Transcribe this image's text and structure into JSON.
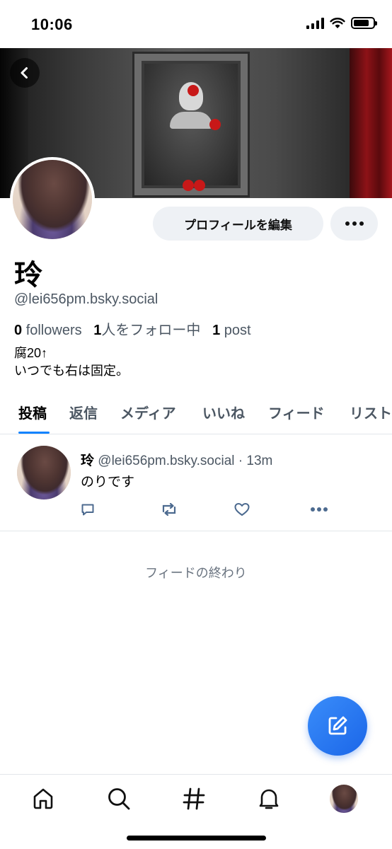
{
  "status_bar": {
    "time": "10:06",
    "battery_level": 0.8,
    "icons": [
      "signal-icon",
      "wifi-icon",
      "battery-icon"
    ]
  },
  "profile": {
    "display_name": "玲",
    "handle": "@lei656pm.bsky.social",
    "stats": {
      "followers_count": "0",
      "followers_label": "followers",
      "following_count": "1",
      "following_label": "人をフォロー中",
      "posts_count": "1",
      "posts_label": "post"
    },
    "bio_line1": "腐20↑",
    "bio_line2": "いつでも右は固定。",
    "edit_button": "プロフィールを編集"
  },
  "tabs": [
    {
      "label": "投稿",
      "active": true
    },
    {
      "label": "返信",
      "active": false
    },
    {
      "label": "メディア",
      "active": false
    },
    {
      "label": "いいね",
      "active": false
    },
    {
      "label": "フィード",
      "active": false
    },
    {
      "label": "リスト",
      "active": false
    }
  ],
  "post": {
    "author": "玲",
    "handle": "@lei656pm.bsky.social",
    "separator": "·",
    "time_ago": "13m",
    "text": "のりです"
  },
  "feed_end_text": "フィードの終わり",
  "bottom_nav": [
    "home-icon",
    "search-icon",
    "hashtag-icon",
    "bell-icon",
    "avatar"
  ],
  "colors": {
    "accent": "#1083fe",
    "fab": "#2a7cf3",
    "muted_text": "#4c5763",
    "button_bg": "#eef1f5"
  }
}
